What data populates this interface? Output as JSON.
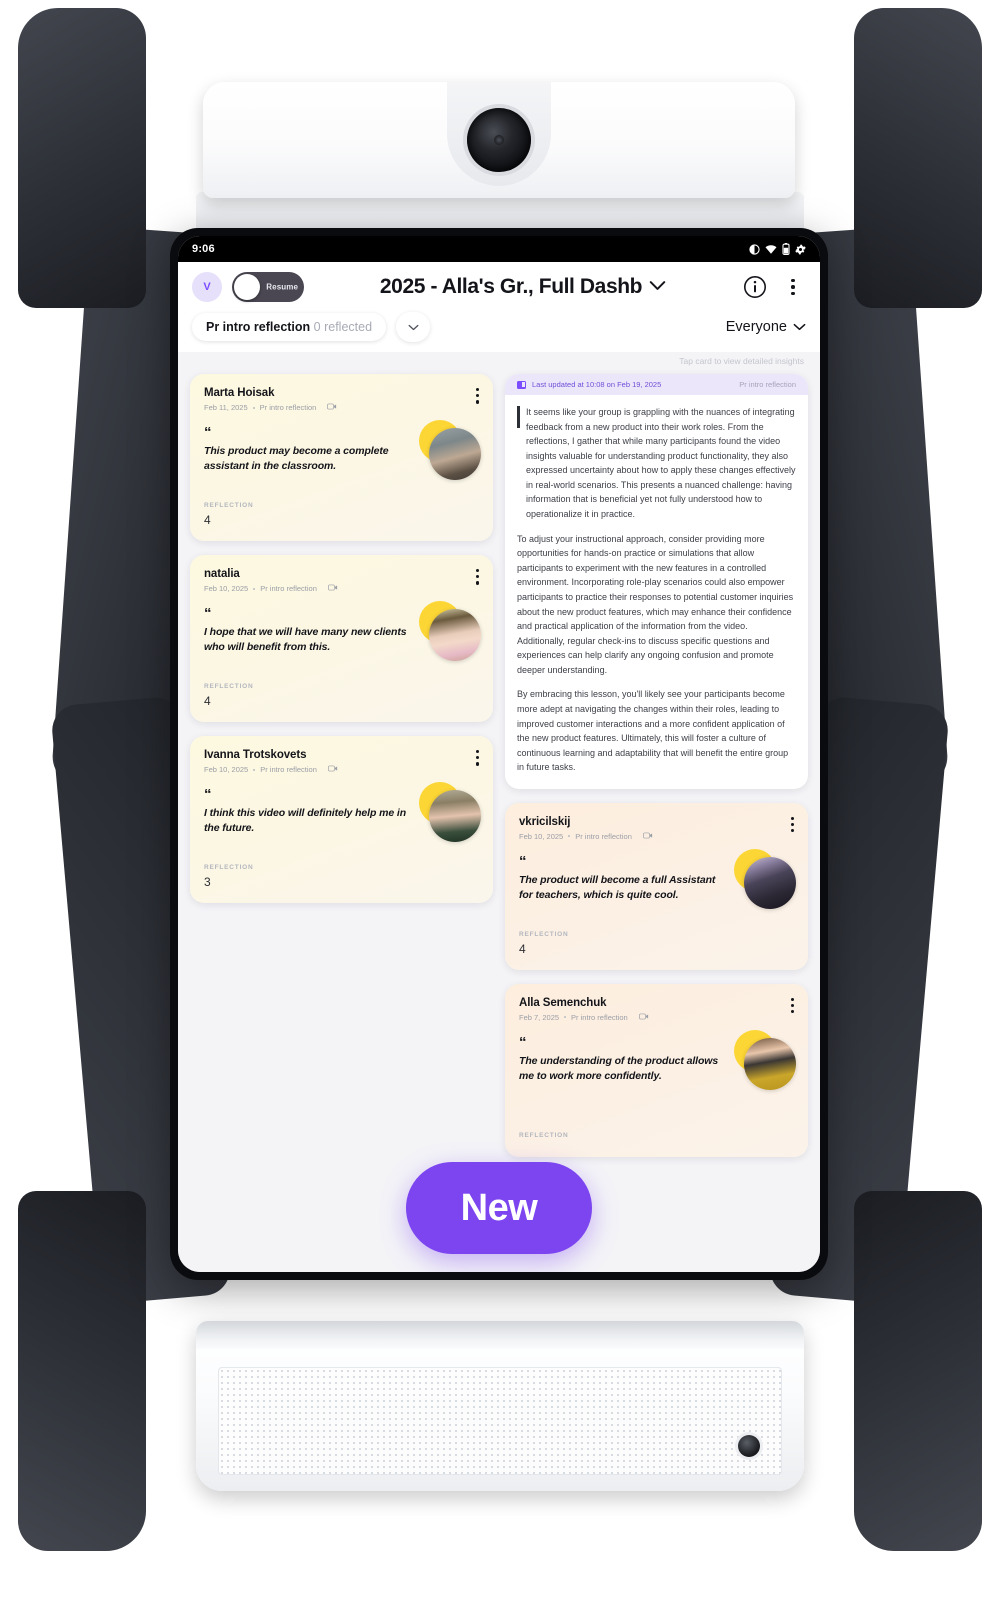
{
  "device": {
    "camera_icon": "camera-lens",
    "speaker_icon": "speaker-grille",
    "port_icon": "audio-port"
  },
  "statusbar": {
    "time": "9:06",
    "icons": [
      "do-not-disturb-icon",
      "wifi-icon",
      "battery-icon",
      "settings-gear-icon"
    ]
  },
  "header": {
    "avatar_initial": "V",
    "toggle_label": "Resume",
    "title": "2025 - Alla's Gr., Full Dashb",
    "title_chevron": "chevron-down-icon",
    "info_icon": "info-icon",
    "more_icon": "kebab-menu-icon"
  },
  "filters": {
    "chip_bold": "Pr intro reflection",
    "chip_muted": "0 reflected",
    "chip_expand_icon": "chevron-down-icon",
    "audience": "Everyone",
    "audience_chevron": "chevron-down-icon"
  },
  "board": {
    "hint": "Tap card to view detailed insights",
    "reflection_label": "REFLECTION"
  },
  "insight": {
    "updated": "Last updated at 10:08 on Feb 19, 2025",
    "tag": "Pr intro reflection",
    "badge_icon": "insight-badge-icon",
    "paragraphs": [
      "It seems like your group is grappling with the nuances of integrating feedback from a new product into their work roles. From the reflections, I gather that while many participants found the video insights valuable for understanding product functionality, they also expressed uncertainty about how to apply these changes effectively in real-world scenarios. This presents a nuanced challenge: having information that is beneficial yet not fully understood how to operationalize it in practice.",
      "To adjust your instructional approach, consider providing more opportunities for hands-on practice or simulations that allow participants to experiment with the new features in a controlled environment. Incorporating role-play scenarios could also empower participants to practice their responses to potential customer inquiries about the new product features, which may enhance their confidence and practical application of the information from the video. Additionally, regular check-ins to discuss specific questions and experiences can help clarify any ongoing confusion and promote deeper understanding.",
      "By embracing this lesson, you'll likely see your participants become more adept at navigating the changes within their roles, leading to improved customer interactions and a more confident application of the new product features. Ultimately, this will foster a culture of continuous learning and adaptability that will benefit the entire group in future tasks."
    ]
  },
  "cards_left": [
    {
      "name": "Marta Hoisak",
      "date": "Feb 11, 2025",
      "topic": "Pr intro reflection",
      "video_icon": "video-camera-icon",
      "quote": "This product may become a complete assistant in the classroom.",
      "reflection_label": "REFLECTION",
      "reflection_count": "4",
      "theme": "yellow",
      "avatar_icon": "participant-avatar"
    },
    {
      "name": "natalia",
      "date": "Feb 10, 2025",
      "topic": "Pr intro reflection",
      "video_icon": "video-camera-icon",
      "quote": "I hope that we will have many new clients who will benefit from this.",
      "reflection_label": "REFLECTION",
      "reflection_count": "4",
      "theme": "yellow",
      "avatar_icon": "participant-avatar"
    },
    {
      "name": "Ivanna Trotskovets",
      "date": "Feb 10, 2025",
      "topic": "Pr intro reflection",
      "video_icon": "video-camera-icon",
      "quote": "I think this video will definitely help me in the future.",
      "reflection_label": "REFLECTION",
      "reflection_count": "3",
      "theme": "yellow",
      "avatar_icon": "participant-avatar"
    }
  ],
  "cards_right": [
    {
      "name": "vkricilskij",
      "date": "Feb 10, 2025",
      "topic": "Pr intro reflection",
      "video_icon": "video-camera-icon",
      "quote": "The product will become a full Assistant for teachers, which is quite cool.",
      "reflection_label": "REFLECTION",
      "reflection_count": "4",
      "theme": "peach",
      "avatar_icon": "participant-avatar"
    },
    {
      "name": "Alla Semenchuk",
      "date": "Feb 7, 2025",
      "topic": "Pr intro reflection",
      "video_icon": "video-camera-icon",
      "quote": "The understanding of the product allows me to work more confidently.",
      "reflection_label": "REFLECTION",
      "reflection_count": "",
      "theme": "peach",
      "avatar_icon": "participant-avatar"
    }
  ],
  "fab": {
    "label": "New"
  },
  "colors": {
    "accent": "#7c45f0",
    "card_yellow": "#fdf8e0",
    "card_peach": "#fdeede",
    "insight_header": "#ece6fb",
    "board_bg": "#f4f4f7"
  }
}
